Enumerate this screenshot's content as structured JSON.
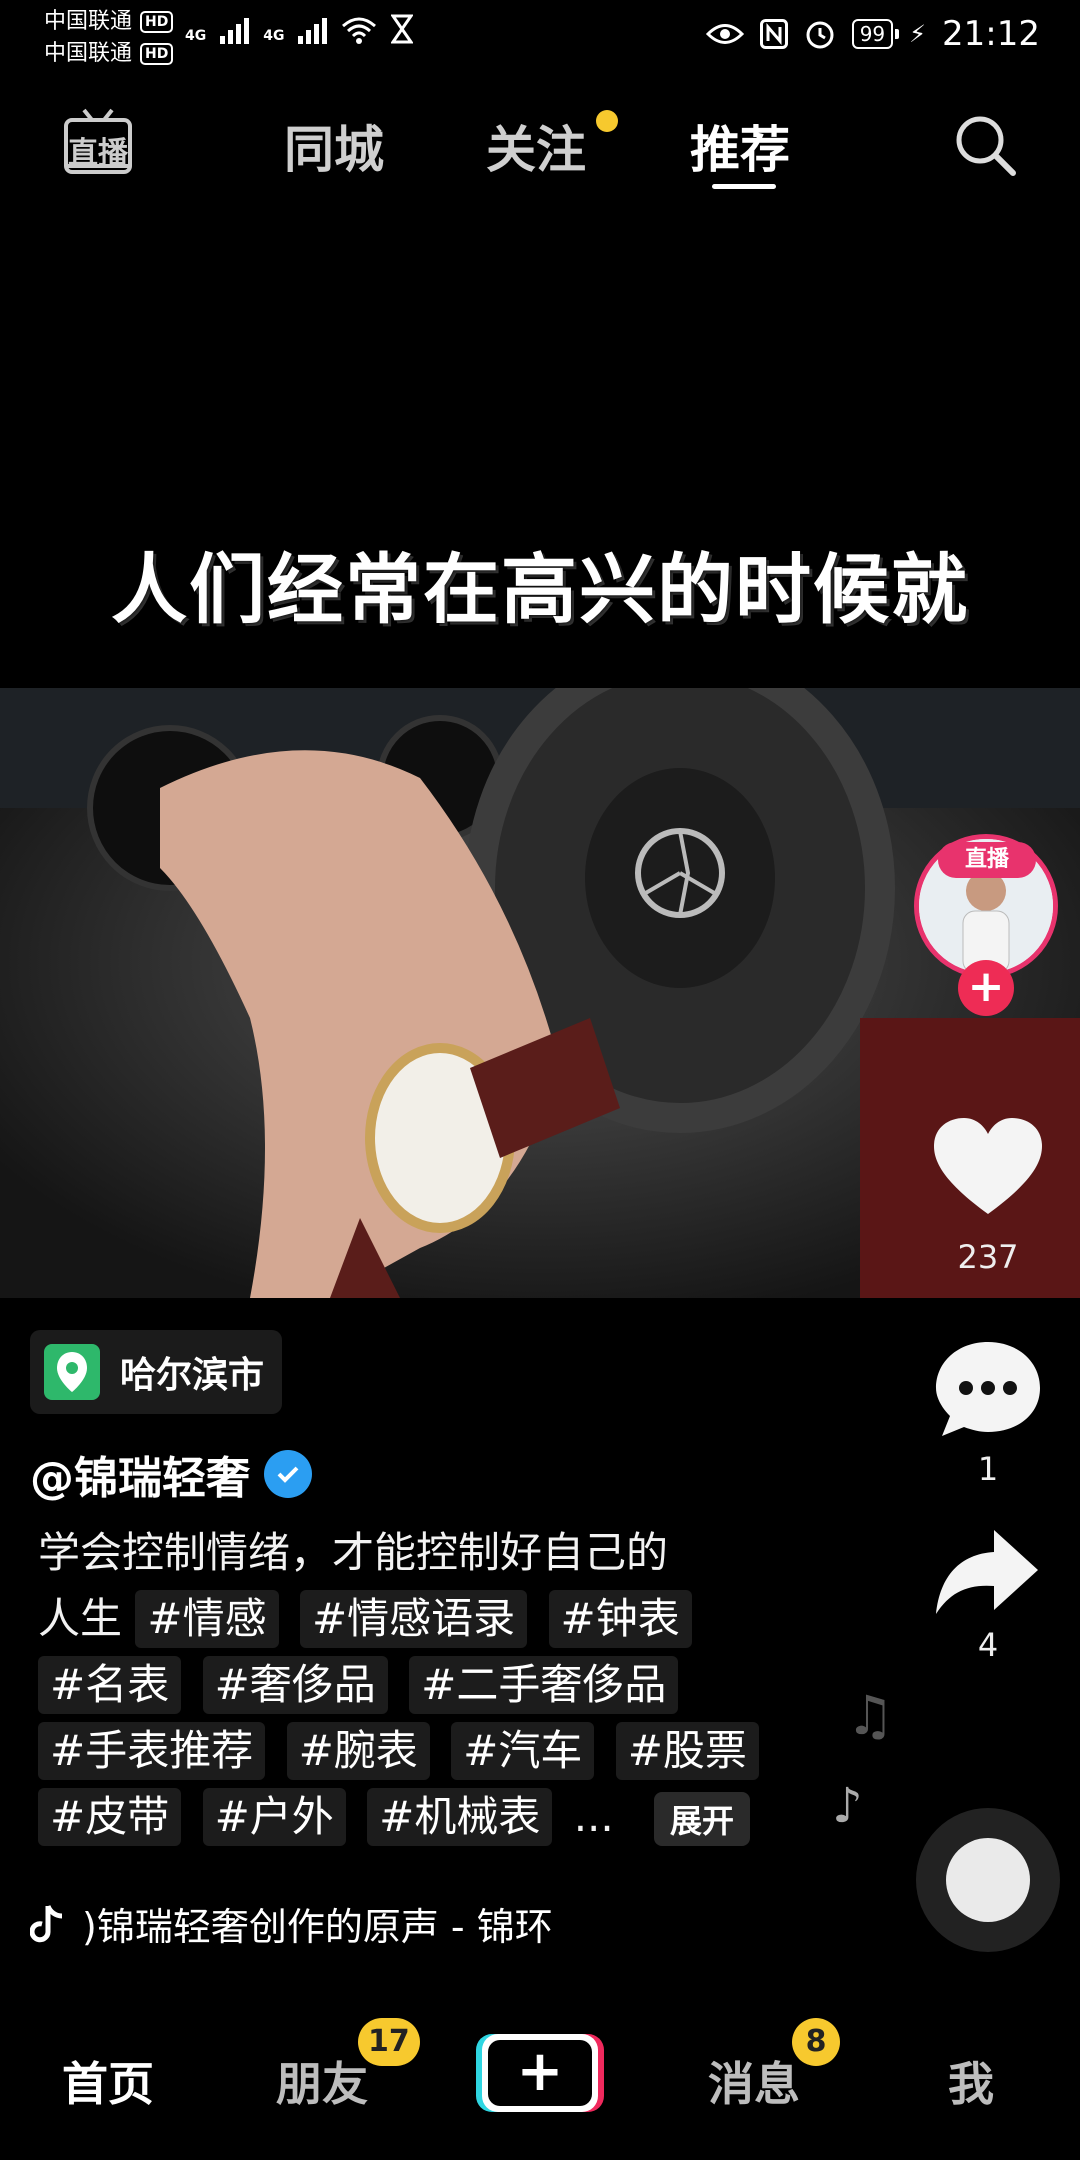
{
  "status_bar": {
    "carrier1": "中国联通",
    "carrier2": "中国联通",
    "hd": "HD",
    "net1": "4G",
    "net2": "4G",
    "battery": "99",
    "time": "21:12"
  },
  "top_nav": {
    "live_icon_label": "直播",
    "tabs": [
      {
        "label": "同城"
      },
      {
        "label": "关注"
      },
      {
        "label": "推荐"
      }
    ]
  },
  "video": {
    "caption": "人们经常在高兴的时候就"
  },
  "side_actions": {
    "live_badge": "直播",
    "like_count": "237",
    "comment_count": "1",
    "share_count": "4"
  },
  "post": {
    "location": "哈尔滨市",
    "author": "@锦瑞轻奢",
    "desc_line1": "学会控制情绪，才能控制好自己的",
    "desc_line2": "人生",
    "tags": [
      "#情感",
      "#情感语录",
      "#钟表",
      "#名表",
      "#奢侈品",
      "#二手奢侈品",
      "#手表推荐",
      "#腕表",
      "#汽车",
      "#股票",
      "#皮带",
      "#户外",
      "#机械表"
    ],
    "ellipsis": "...",
    "expand_label": "展开",
    "music": ")锦瑞轻奢创作的原声 - 锦环"
  },
  "bottom_nav": {
    "home": "首页",
    "friends": "朋友",
    "friends_badge": "17",
    "plus": "+",
    "messages": "消息",
    "messages_badge": "8",
    "me": "我"
  },
  "colors": {
    "accent_pink": "#e8336d",
    "badge_yellow": "#f7c92e",
    "location_green": "#2eb86b",
    "verified_blue": "#2b9ef2"
  }
}
